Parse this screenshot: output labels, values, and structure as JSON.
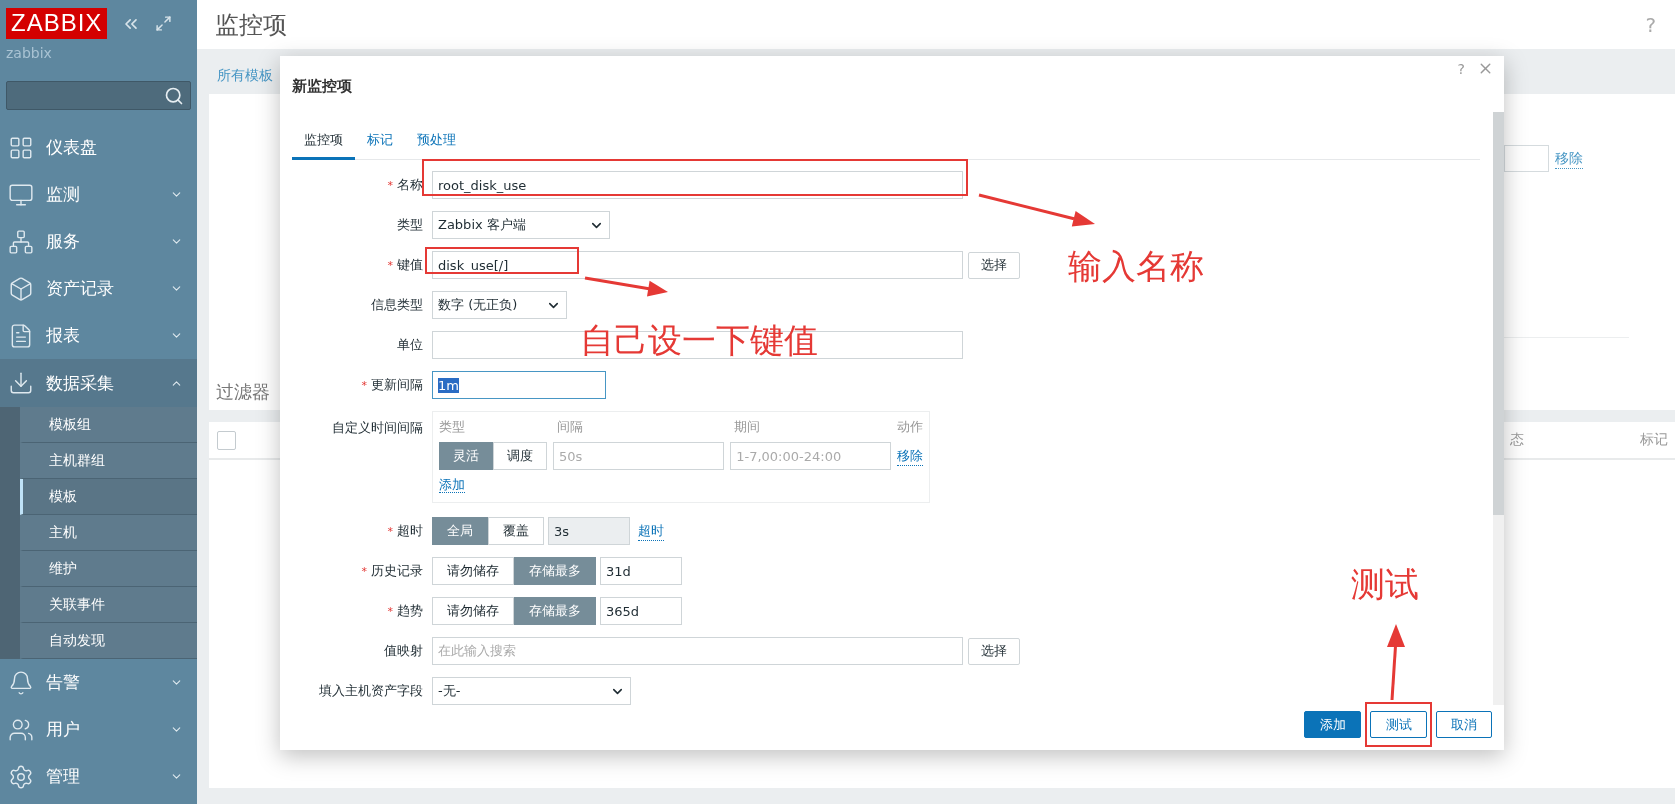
{
  "sidebar": {
    "logo": "ZABBIX",
    "server": "zabbix",
    "menu": [
      {
        "label": "仪表盘",
        "kind": "link"
      },
      {
        "label": "监测",
        "kind": "group",
        "expanded": false
      },
      {
        "label": "服务",
        "kind": "group",
        "expanded": false
      },
      {
        "label": "资产记录",
        "kind": "group",
        "expanded": false
      },
      {
        "label": "报表",
        "kind": "group",
        "expanded": false
      },
      {
        "label": "数据采集",
        "kind": "group",
        "expanded": true,
        "children": [
          {
            "label": "模板组",
            "selected": false
          },
          {
            "label": "主机群组",
            "selected": false
          },
          {
            "label": "模板",
            "selected": true
          },
          {
            "label": "主机",
            "selected": false
          },
          {
            "label": "维护",
            "selected": false
          },
          {
            "label": "关联事件",
            "selected": false
          },
          {
            "label": "自动发现",
            "selected": false
          }
        ]
      },
      {
        "label": "告警",
        "kind": "group",
        "expanded": false
      },
      {
        "label": "用户",
        "kind": "group",
        "expanded": false
      },
      {
        "label": "管理",
        "kind": "group",
        "expanded": false
      }
    ]
  },
  "page": {
    "title": "监控项",
    "help": "?",
    "breadcrumb": "所有模板",
    "filter_title": "过滤器",
    "filter_remove": "移除",
    "select_all": {
      "checked": false
    },
    "table_columns": [
      "态",
      "标记"
    ]
  },
  "dialog": {
    "title": "新监控项",
    "help": "?",
    "required_mark": "*",
    "tabs": [
      {
        "label": "监控项",
        "selected": true
      },
      {
        "label": "标记",
        "selected": false
      },
      {
        "label": "预处理",
        "selected": false
      }
    ],
    "fields": [
      {
        "label": "名称",
        "required": true,
        "kind": "text",
        "value": "root_disk_use"
      },
      {
        "label": "类型",
        "required": false,
        "kind": "select",
        "value": "Zabbix 客户端"
      },
      {
        "label": "键值",
        "required": true,
        "kind": "text_button",
        "value": "disk_use[/]",
        "button": "选择"
      },
      {
        "label": "信息类型",
        "required": false,
        "kind": "select",
        "value": "数字 (无正负)"
      },
      {
        "label": "单位",
        "required": false,
        "kind": "text"
      },
      {
        "label": "更新间隔",
        "required": true,
        "kind": "short_text",
        "value": "1m",
        "focused": true
      },
      {
        "label": "自定义时间间隔",
        "required": false,
        "kind": "intervals",
        "columns": [
          "类型",
          "间隔",
          "期间",
          "动作"
        ],
        "rows": [
          {
            "options": [
              {
                "label": "灵活",
                "selected": true
              },
              {
                "label": "调度",
                "selected": false
              }
            ],
            "interval": {
              "placeholder": "50s"
            },
            "period": {
              "placeholder": "1-7,00:00-24:00"
            },
            "action": "移除"
          }
        ],
        "add": "添加"
      },
      {
        "label": "超时",
        "required": true,
        "kind": "segmented",
        "options": [
          {
            "label": "全局",
            "selected": true
          },
          {
            "label": "覆盖",
            "selected": false
          }
        ],
        "value": "3s",
        "disabled": true,
        "link": "超时"
      },
      {
        "label": "历史记录",
        "required": true,
        "kind": "segmented",
        "options": [
          {
            "label": "请勿储存",
            "selected": false
          },
          {
            "label": "存储最多",
            "selected": true
          }
        ],
        "value": "31d",
        "disabled": false
      },
      {
        "label": "趋势",
        "required": true,
        "kind": "segmented",
        "options": [
          {
            "label": "请勿储存",
            "selected": false
          },
          {
            "label": "存储最多",
            "selected": true
          }
        ],
        "value": "365d",
        "disabled": false
      },
      {
        "label": "值映射",
        "required": false,
        "kind": "text_button",
        "placeholder": "在此输入搜索",
        "button": "选择"
      },
      {
        "label": "填入主机资产字段",
        "required": false,
        "kind": "select",
        "value": "-无-"
      }
    ],
    "buttons": [
      {
        "label": "添加",
        "primary": true
      },
      {
        "label": "测试",
        "primary": false
      },
      {
        "label": "取消",
        "primary": false
      }
    ]
  },
  "annotations": [
    {
      "text": "输入名称"
    },
    {
      "text": "自己设一下键值"
    },
    {
      "text": "测试"
    }
  ]
}
